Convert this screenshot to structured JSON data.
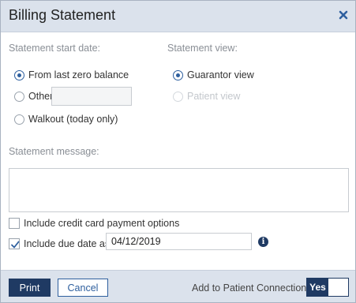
{
  "dialog": {
    "title": "Billing Statement"
  },
  "start_date": {
    "label": "Statement start date:",
    "options": [
      {
        "label": "From last zero balance",
        "checked": true
      },
      {
        "label": "Other",
        "checked": false
      },
      {
        "label": "Walkout (today only)",
        "checked": false
      }
    ],
    "other_value": ""
  },
  "view": {
    "label": "Statement view:",
    "options": [
      {
        "label": "Guarantor view",
        "checked": true,
        "disabled": false
      },
      {
        "label": "Patient view",
        "checked": false,
        "disabled": true
      }
    ]
  },
  "message": {
    "label": "Statement message:",
    "value": ""
  },
  "options": {
    "credit_card_label": "Include credit card payment options",
    "credit_card_checked": false,
    "due_date_label": "Include due date as",
    "due_date_checked": true,
    "due_date_value": "04/12/2019"
  },
  "footer": {
    "print_label": "Print",
    "cancel_label": "Cancel",
    "connection_label": "Add to Patient Connection",
    "toggle_label": "Yes"
  },
  "icons": {
    "close": "close-icon",
    "info": "info-icon",
    "check": "checkmark-icon"
  },
  "colors": {
    "accent": "#1f3a63",
    "link": "#2e5f9e",
    "header_bg": "#dbe2ec"
  }
}
